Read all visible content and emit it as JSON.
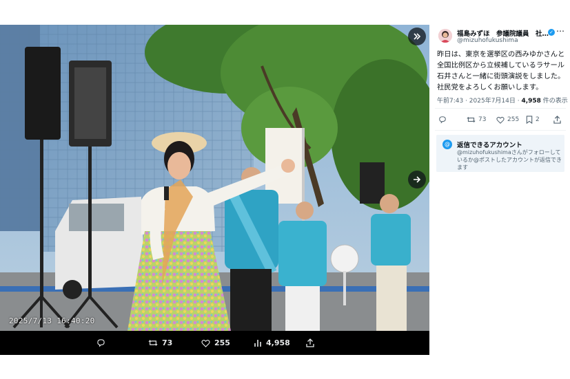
{
  "viewer": {
    "photo_timestamp": "2025/7/13 16:40:20",
    "collapse_icon": "chevrons-right-icon",
    "next_icon": "arrow-right-icon",
    "actions": {
      "reply_count": "",
      "repost_count": "73",
      "like_count": "255",
      "views_count": "4,958"
    }
  },
  "post": {
    "author_name": "福島みずほ　参議院議員　社…",
    "handle": "@mizuhofukushima",
    "verified": true,
    "text": "昨日は、東京を選挙区の西みゆかさんと全国比例区から立候補しているラサール石井さんと一緒に街頭演説をしました。社民党をよろしくお願いします。",
    "time": "午前7:43 · 2025年7月14日 · ",
    "views": "4,958",
    "views_suffix": " 件の表示",
    "stats": {
      "reply_count": "",
      "repost_count": "73",
      "like_count": "255",
      "bookmark_count": "2"
    }
  },
  "reply_notice": {
    "title": "返信できるアカウント",
    "description": "@mizuhofukushimaさんがフォローしているか@ポストしたアカウントが返信できます"
  },
  "colors": {
    "accent": "#1d9bf0",
    "text": "#0f1419",
    "secondary": "#536471"
  }
}
